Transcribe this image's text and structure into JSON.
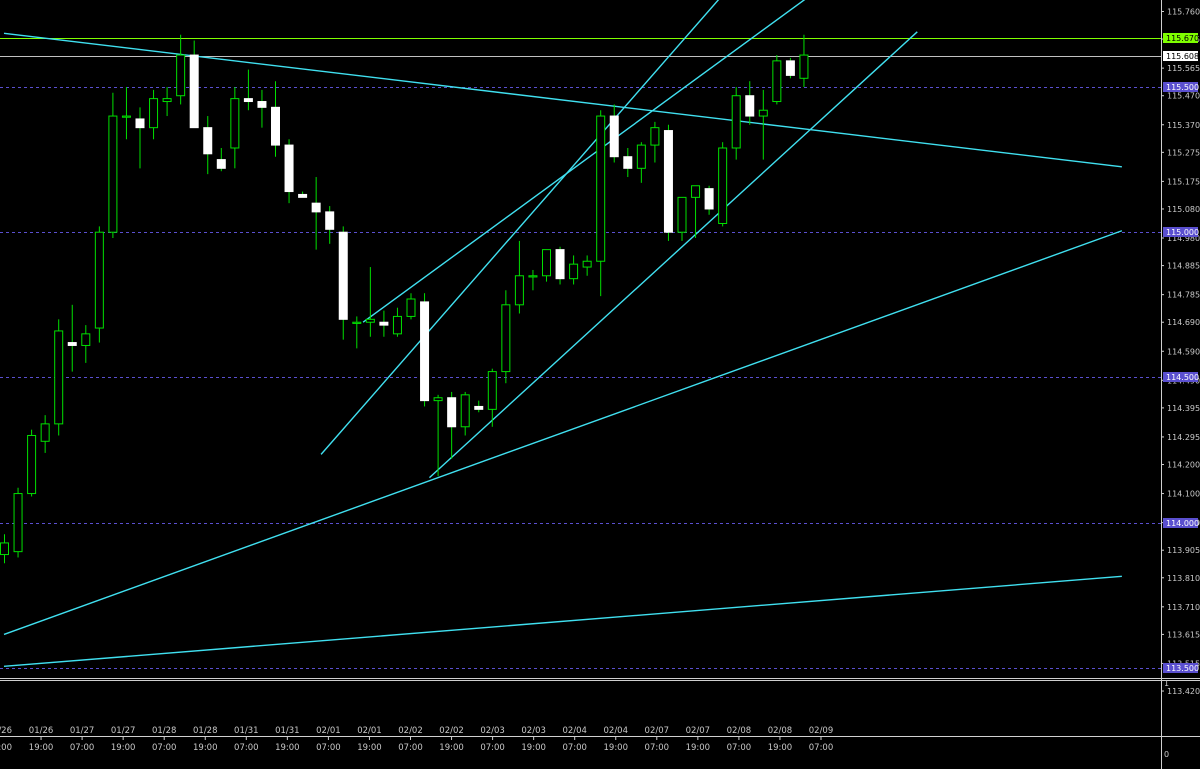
{
  "chart_data": {
    "type": "candlestick",
    "price_axis": {
      "ylim": [
        113.4,
        115.8
      ],
      "tick_labels": [
        "115.760",
        "115.665",
        "115.565",
        "115.470",
        "115.370",
        "115.275",
        "115.175",
        "115.080",
        "114.980",
        "114.885",
        "114.785",
        "114.690",
        "114.590",
        "114.490",
        "114.395",
        "114.295",
        "114.200",
        "114.100",
        "114.000",
        "113.905",
        "113.810",
        "113.710",
        "113.615",
        "113.515",
        "113.420"
      ]
    },
    "time_axis": {
      "labels": [
        {
          "date": "01/26",
          "time": "07:00"
        },
        {
          "date": "01/26",
          "time": "19:00"
        },
        {
          "date": "01/27",
          "time": "07:00"
        },
        {
          "date": "01/27",
          "time": "19:00"
        },
        {
          "date": "01/28",
          "time": "07:00"
        },
        {
          "date": "01/28",
          "time": "19:00"
        },
        {
          "date": "01/31",
          "time": "07:00"
        },
        {
          "date": "01/31",
          "time": "19:00"
        },
        {
          "date": "02/01",
          "time": "07:00"
        },
        {
          "date": "02/01",
          "time": "19:00"
        },
        {
          "date": "02/02",
          "time": "07:00"
        },
        {
          "date": "02/02",
          "time": "19:00"
        },
        {
          "date": "02/03",
          "time": "07:00"
        },
        {
          "date": "02/03",
          "time": "19:00"
        },
        {
          "date": "02/04",
          "time": "07:00"
        },
        {
          "date": "02/04",
          "time": "19:00"
        },
        {
          "date": "02/07",
          "time": "07:00"
        },
        {
          "date": "02/07",
          "time": "19:00"
        },
        {
          "date": "02/08",
          "time": "07:00"
        },
        {
          "date": "02/08",
          "time": "19:00"
        },
        {
          "date": "02/09",
          "time": "07:00"
        }
      ]
    },
    "level_lines": [
      {
        "price": 115.67,
        "label": "115.670",
        "color": "#7fff00",
        "style": "solid",
        "tag_bg": "#7fff00",
        "tag_fg": "#000000"
      },
      {
        "price": 115.608,
        "label": "115.608",
        "color": "#c0c0c0",
        "style": "solid",
        "tag_bg": "#ffffff",
        "tag_fg": "#000000"
      },
      {
        "price": 115.5,
        "label": "115.500",
        "color": "#5a4fcf",
        "style": "dashed",
        "tag_bg": "#5a4fcf",
        "tag_fg": "#ffffff"
      },
      {
        "price": 115.0,
        "label": "115.000",
        "color": "#5a4fcf",
        "style": "dashed",
        "tag_bg": "#5a4fcf",
        "tag_fg": "#ffffff"
      },
      {
        "price": 114.5,
        "label": "114.500",
        "color": "#5a4fcf",
        "style": "dashed",
        "tag_bg": "#5a4fcf",
        "tag_fg": "#ffffff"
      },
      {
        "price": 114.0,
        "label": "114.000",
        "color": "#5a4fcf",
        "style": "dashed",
        "tag_bg": "#5a4fcf",
        "tag_fg": "#ffffff"
      },
      {
        "price": 113.5,
        "label": "113.500",
        "color": "#5a4fcf",
        "style": "dashed",
        "tag_bg": "#5a4fcf",
        "tag_fg": "#ffffff"
      }
    ],
    "trend_lines": [
      {
        "from": [
          0,
          115.685
        ],
        "to": [
          82.5,
          115.225
        ],
        "color": "#40e0f0"
      },
      {
        "from": [
          0,
          113.615
        ],
        "to": [
          82.5,
          115.005
        ],
        "color": "#40e0f0"
      },
      {
        "from": [
          0,
          113.505
        ],
        "to": [
          82.5,
          113.815
        ],
        "color": "#40e0f0"
      },
      {
        "from": [
          23.4,
          114.235
        ],
        "to": [
          53.0,
          115.815
        ],
        "color": "#40e0f0"
      },
      {
        "from": [
          26.5,
          114.69
        ],
        "to": [
          59.5,
          115.815
        ],
        "color": "#40e0f0"
      },
      {
        "from": [
          31.4,
          114.155
        ],
        "to": [
          67.4,
          115.69
        ],
        "color": "#40e0f0"
      }
    ],
    "indicator_scale": [
      "1",
      "0"
    ],
    "candles": [
      {
        "o": 113.89,
        "h": 113.96,
        "l": 113.86,
        "c": 113.93
      },
      {
        "o": 113.9,
        "h": 114.12,
        "l": 113.88,
        "c": 114.1
      },
      {
        "o": 114.1,
        "h": 114.32,
        "l": 114.09,
        "c": 114.3
      },
      {
        "o": 114.28,
        "h": 114.37,
        "l": 114.24,
        "c": 114.34
      },
      {
        "o": 114.34,
        "h": 114.7,
        "l": 114.3,
        "c": 114.66
      },
      {
        "o": 114.62,
        "h": 114.75,
        "l": 114.52,
        "c": 114.61
      },
      {
        "o": 114.61,
        "h": 114.68,
        "l": 114.55,
        "c": 114.65
      },
      {
        "o": 114.67,
        "h": 115.02,
        "l": 114.62,
        "c": 115.0
      },
      {
        "o": 115.0,
        "h": 115.48,
        "l": 114.98,
        "c": 115.4
      },
      {
        "o": 115.4,
        "h": 115.5,
        "l": 115.32,
        "c": 115.4
      },
      {
        "o": 115.39,
        "h": 115.43,
        "l": 115.22,
        "c": 115.36
      },
      {
        "o": 115.36,
        "h": 115.49,
        "l": 115.32,
        "c": 115.46
      },
      {
        "o": 115.45,
        "h": 115.5,
        "l": 115.4,
        "c": 115.46
      },
      {
        "o": 115.47,
        "h": 115.68,
        "l": 115.44,
        "c": 115.61
      },
      {
        "o": 115.61,
        "h": 115.66,
        "l": 115.36,
        "c": 115.36
      },
      {
        "o": 115.36,
        "h": 115.4,
        "l": 115.2,
        "c": 115.27
      },
      {
        "o": 115.25,
        "h": 115.29,
        "l": 115.21,
        "c": 115.22
      },
      {
        "o": 115.29,
        "h": 115.5,
        "l": 115.22,
        "c": 115.46
      },
      {
        "o": 115.46,
        "h": 115.56,
        "l": 115.42,
        "c": 115.45
      },
      {
        "o": 115.45,
        "h": 115.49,
        "l": 115.36,
        "c": 115.43
      },
      {
        "o": 115.43,
        "h": 115.52,
        "l": 115.26,
        "c": 115.3
      },
      {
        "o": 115.3,
        "h": 115.32,
        "l": 115.1,
        "c": 115.14
      },
      {
        "o": 115.13,
        "h": 115.14,
        "l": 115.12,
        "c": 115.12
      },
      {
        "o": 115.1,
        "h": 115.19,
        "l": 114.94,
        "c": 115.07
      },
      {
        "o": 115.07,
        "h": 115.09,
        "l": 114.96,
        "c": 115.01
      },
      {
        "o": 115.0,
        "h": 115.02,
        "l": 114.63,
        "c": 114.7
      },
      {
        "o": 114.69,
        "h": 114.71,
        "l": 114.6,
        "c": 114.69
      },
      {
        "o": 114.69,
        "h": 114.88,
        "l": 114.64,
        "c": 114.7
      },
      {
        "o": 114.69,
        "h": 114.73,
        "l": 114.64,
        "c": 114.68
      },
      {
        "o": 114.65,
        "h": 114.74,
        "l": 114.64,
        "c": 114.71
      },
      {
        "o": 114.71,
        "h": 114.79,
        "l": 114.7,
        "c": 114.77
      },
      {
        "o": 114.76,
        "h": 114.79,
        "l": 114.4,
        "c": 114.42
      },
      {
        "o": 114.42,
        "h": 114.44,
        "l": 114.16,
        "c": 114.43
      },
      {
        "o": 114.43,
        "h": 114.45,
        "l": 114.22,
        "c": 114.33
      },
      {
        "o": 114.33,
        "h": 114.45,
        "l": 114.3,
        "c": 114.44
      },
      {
        "o": 114.4,
        "h": 114.42,
        "l": 114.38,
        "c": 114.39
      },
      {
        "o": 114.39,
        "h": 114.53,
        "l": 114.33,
        "c": 114.52
      },
      {
        "o": 114.52,
        "h": 114.8,
        "l": 114.48,
        "c": 114.75
      },
      {
        "o": 114.75,
        "h": 114.97,
        "l": 114.72,
        "c": 114.85
      },
      {
        "o": 114.85,
        "h": 114.87,
        "l": 114.8,
        "c": 114.85
      },
      {
        "o": 114.85,
        "h": 114.94,
        "l": 114.83,
        "c": 114.94
      },
      {
        "o": 114.94,
        "h": 114.95,
        "l": 114.82,
        "c": 114.84
      },
      {
        "o": 114.84,
        "h": 114.92,
        "l": 114.82,
        "c": 114.89
      },
      {
        "o": 114.88,
        "h": 114.92,
        "l": 114.85,
        "c": 114.9
      },
      {
        "o": 114.9,
        "h": 115.42,
        "l": 114.78,
        "c": 115.4
      },
      {
        "o": 115.4,
        "h": 115.44,
        "l": 115.24,
        "c": 115.26
      },
      {
        "o": 115.26,
        "h": 115.29,
        "l": 115.19,
        "c": 115.22
      },
      {
        "o": 115.22,
        "h": 115.31,
        "l": 115.17,
        "c": 115.3
      },
      {
        "o": 115.3,
        "h": 115.38,
        "l": 115.24,
        "c": 115.36
      },
      {
        "o": 115.35,
        "h": 115.37,
        "l": 114.97,
        "c": 115.0
      },
      {
        "o": 115.0,
        "h": 115.12,
        "l": 114.97,
        "c": 115.12
      },
      {
        "o": 115.12,
        "h": 115.16,
        "l": 114.98,
        "c": 115.16
      },
      {
        "o": 115.15,
        "h": 115.16,
        "l": 115.06,
        "c": 115.08
      },
      {
        "o": 115.03,
        "h": 115.31,
        "l": 115.02,
        "c": 115.29
      },
      {
        "o": 115.29,
        "h": 115.5,
        "l": 115.25,
        "c": 115.47
      },
      {
        "o": 115.47,
        "h": 115.52,
        "l": 115.37,
        "c": 115.4
      },
      {
        "o": 115.4,
        "h": 115.49,
        "l": 115.25,
        "c": 115.42
      },
      {
        "o": 115.45,
        "h": 115.61,
        "l": 115.44,
        "c": 115.59
      },
      {
        "o": 115.59,
        "h": 115.6,
        "l": 115.53,
        "c": 115.54
      },
      {
        "o": 115.53,
        "h": 115.68,
        "l": 115.5,
        "c": 115.61
      }
    ]
  }
}
